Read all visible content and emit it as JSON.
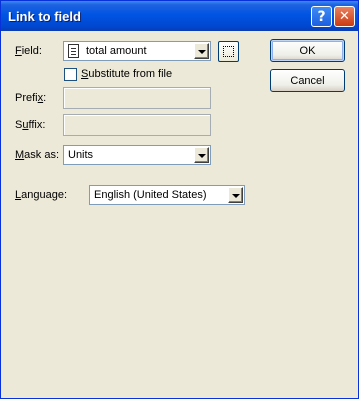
{
  "window": {
    "title": "Link to field"
  },
  "titlebar_buttons": {
    "help": "?",
    "close": "✕"
  },
  "form": {
    "field": {
      "label_prefix": "",
      "label_accel": "F",
      "label_rest": "ield:",
      "value": "total amount"
    },
    "substitute": {
      "label_prefix": "",
      "label_accel": "S",
      "label_rest": "ubstitute from file",
      "checked": false
    },
    "prefix": {
      "label_prefix": "Prefi",
      "label_accel": "x",
      "label_rest": ":",
      "value": ""
    },
    "suffix": {
      "label_prefix": "S",
      "label_accel": "u",
      "label_rest": "ffix:",
      "value": ""
    },
    "mask_as": {
      "label_prefix": "",
      "label_accel": "M",
      "label_rest": "ask as:",
      "value": "Units"
    },
    "language": {
      "label_prefix": "",
      "label_accel": "L",
      "label_rest": "anguage:",
      "value": "English (United States)"
    }
  },
  "buttons": {
    "ok": "OK",
    "cancel": "Cancel"
  }
}
